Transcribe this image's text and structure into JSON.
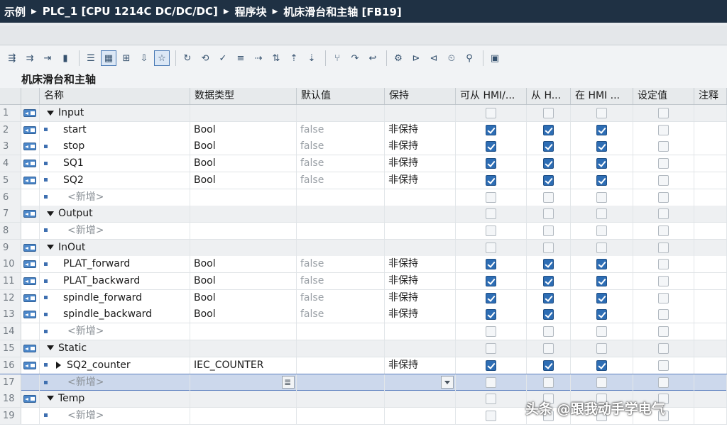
{
  "breadcrumb": [
    "示例",
    "PLC_1 [CPU 1214C DC/DC/DC]",
    "程序块",
    "机床滑台和主轴 [FB19]"
  ],
  "toolbar_icons": [
    "insert-row-icon",
    "add-row-icon",
    "export-icon",
    "monitor-icon",
    "indent-icon",
    "view-icon",
    "compare-icon",
    "download-icon",
    "favorites-icon",
    "call-icon",
    "network-icon",
    "compile-icon",
    "list-icon",
    "goto-icon",
    "sort-icon",
    "move-up-icon",
    "move-down-icon",
    "branch-icon",
    "jump-icon",
    "return-icon",
    "settings-icon",
    "network-nav-icon",
    "network-collapse-icon",
    "timer-icon",
    "search-icon",
    "db-icon"
  ],
  "block_title": "机床滑台和主轴",
  "columns": [
    "名称",
    "数据类型",
    "默认值",
    "保持",
    "可从 HMI/...",
    "从 H...",
    "在 HMI ...",
    "设定值",
    "注释"
  ],
  "rows": [
    {
      "num": "1",
      "kind": "section",
      "name": "Input",
      "type": "",
      "default": "",
      "retain": "",
      "a": false,
      "b": false,
      "c": false,
      "d": false
    },
    {
      "num": "2",
      "kind": "var",
      "name": "start",
      "type": "Bool",
      "default": "false",
      "retain": "非保持",
      "a": true,
      "b": true,
      "c": true,
      "d": false
    },
    {
      "num": "3",
      "kind": "var",
      "name": "stop",
      "type": "Bool",
      "default": "false",
      "retain": "非保持",
      "a": true,
      "b": true,
      "c": true,
      "d": false
    },
    {
      "num": "4",
      "kind": "var",
      "name": "SQ1",
      "type": "Bool",
      "default": "false",
      "retain": "非保持",
      "a": true,
      "b": true,
      "c": true,
      "d": false
    },
    {
      "num": "5",
      "kind": "var",
      "name": "SQ2",
      "type": "Bool",
      "default": "false",
      "retain": "非保持",
      "a": true,
      "b": true,
      "c": true,
      "d": false
    },
    {
      "num": "6",
      "kind": "new",
      "name": "<新增>",
      "type": "",
      "default": "",
      "retain": "",
      "a": false,
      "b": false,
      "c": false,
      "d": false
    },
    {
      "num": "7",
      "kind": "section",
      "name": "Output",
      "type": "",
      "default": "",
      "retain": "",
      "a": false,
      "b": false,
      "c": false,
      "d": false
    },
    {
      "num": "8",
      "kind": "new",
      "name": "<新增>",
      "type": "",
      "default": "",
      "retain": "",
      "a": false,
      "b": false,
      "c": false,
      "d": false
    },
    {
      "num": "9",
      "kind": "section",
      "name": "InOut",
      "type": "",
      "default": "",
      "retain": "",
      "a": false,
      "b": false,
      "c": false,
      "d": false
    },
    {
      "num": "10",
      "kind": "var",
      "name": "PLAT_forward",
      "type": "Bool",
      "default": "false",
      "retain": "非保持",
      "a": true,
      "b": true,
      "c": true,
      "d": false
    },
    {
      "num": "11",
      "kind": "var",
      "name": "PLAT_backward",
      "type": "Bool",
      "default": "false",
      "retain": "非保持",
      "a": true,
      "b": true,
      "c": true,
      "d": false
    },
    {
      "num": "12",
      "kind": "var",
      "name": "spindle_forward",
      "type": "Bool",
      "default": "false",
      "retain": "非保持",
      "a": true,
      "b": true,
      "c": true,
      "d": false
    },
    {
      "num": "13",
      "kind": "var",
      "name": "spindle_backward",
      "type": "Bool",
      "default": "false",
      "retain": "非保持",
      "a": true,
      "b": true,
      "c": true,
      "d": false
    },
    {
      "num": "14",
      "kind": "new",
      "name": "<新增>",
      "type": "",
      "default": "",
      "retain": "",
      "a": false,
      "b": false,
      "c": false,
      "d": false
    },
    {
      "num": "15",
      "kind": "section",
      "name": "Static",
      "type": "",
      "default": "",
      "retain": "",
      "a": false,
      "b": false,
      "c": false,
      "d": false
    },
    {
      "num": "16",
      "kind": "struct",
      "name": "SQ2_counter",
      "type": "IEC_COUNTER",
      "default": "",
      "retain": "非保持",
      "a": true,
      "b": true,
      "c": true,
      "d": false
    },
    {
      "num": "17",
      "kind": "new-selected",
      "name": "<新增>",
      "type": "",
      "default": "",
      "retain": "",
      "a": false,
      "b": false,
      "c": false,
      "d": false
    },
    {
      "num": "18",
      "kind": "section",
      "name": "Temp",
      "type": "",
      "default": "",
      "retain": "",
      "a": false,
      "b": false,
      "c": false,
      "d": false
    },
    {
      "num": "19",
      "kind": "new",
      "name": "<新增>",
      "type": "",
      "default": "",
      "retain": "",
      "a": false,
      "b": false,
      "c": false,
      "d": false
    }
  ],
  "watermark": "头条 @跟我动手学电气"
}
